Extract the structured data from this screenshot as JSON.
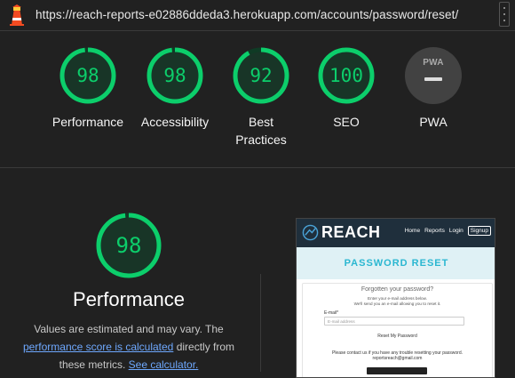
{
  "browser": {
    "url": "https://reach-reports-e02886ddeda3.herokuapp.com/accounts/password/reset/"
  },
  "colors": {
    "pass": "#0cce6b",
    "background": "#212121",
    "link": "#6ea8fe"
  },
  "gauges": [
    {
      "score": "98",
      "value": 98,
      "label": "Performance"
    },
    {
      "score": "98",
      "value": 98,
      "label": "Accessibility"
    },
    {
      "score": "92",
      "value": 92,
      "label": "Best Practices"
    },
    {
      "score": "100",
      "value": 100,
      "label": "SEO"
    }
  ],
  "pwa": {
    "badge": "PWA",
    "label": "PWA"
  },
  "performance": {
    "score": "98",
    "value": 98,
    "title": "Performance",
    "desc_start": "Values are estimated and may vary. The ",
    "link1": "performance score is calculated",
    "desc_mid": " directly from these metrics. ",
    "link2": "See calculator."
  },
  "screenshot": {
    "brand": "REACH",
    "nav": {
      "home": "Home",
      "reports": "Reports",
      "login": "Login",
      "signup": "Signup"
    },
    "hero_title": "PASSWORD RESET",
    "card": {
      "heading": "Forgotten your password?",
      "sub1": "Enter your e-mail address below.",
      "sub2": "We'll send you an e-mail allowing you to reset it.",
      "email_label": "E-mail*",
      "email_placeholder": "E-mail address",
      "reset_link": "Reset My Password",
      "contact1": "Please contact us if you have any trouble resetting your password.",
      "contact2": "reportsreach@gmail.com"
    }
  }
}
